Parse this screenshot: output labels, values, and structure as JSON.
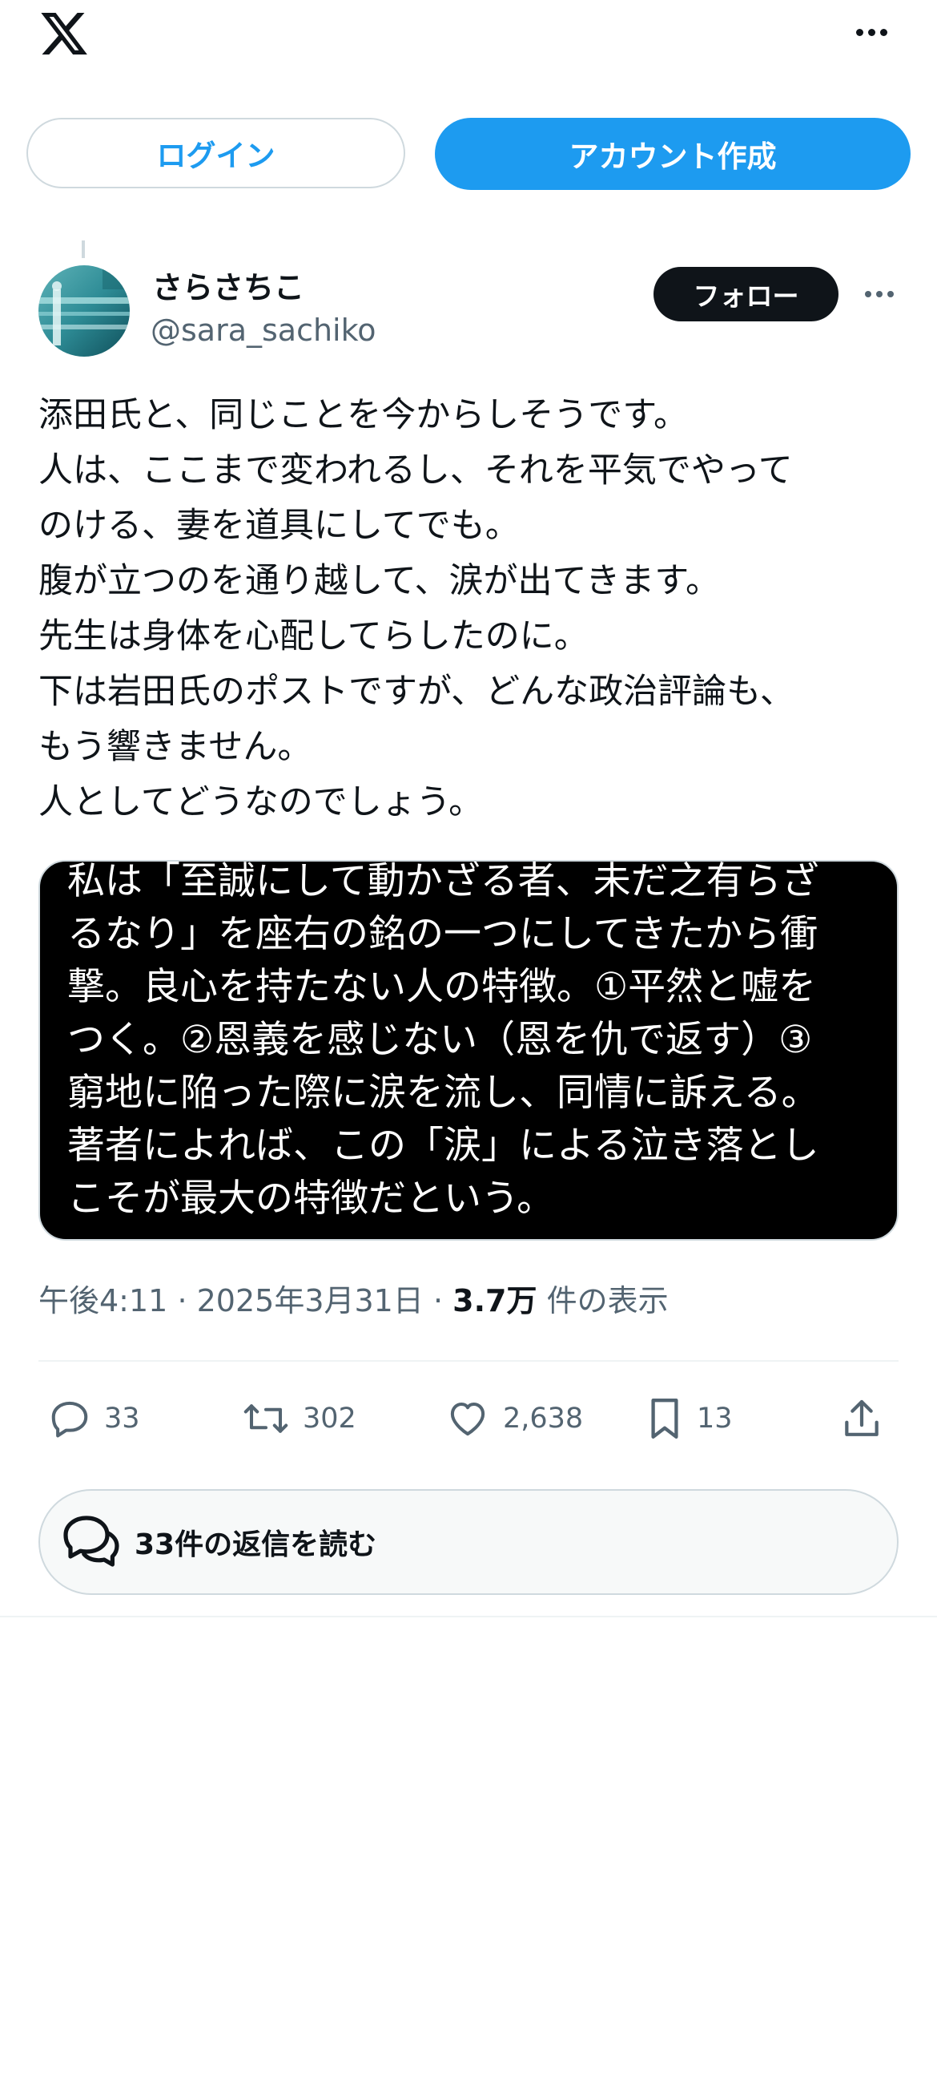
{
  "header": {
    "logo_icon": "x-logo-icon",
    "more_icon": "more-horizontal-icon"
  },
  "auth": {
    "login_label": "ログイン",
    "signup_label": "アカウント作成",
    "accent_color": "#1d9bf0"
  },
  "post": {
    "author": {
      "display_name": "さらさちこ",
      "handle": "@sara_sachiko"
    },
    "follow_label": "フォロー",
    "text_lines": [
      "添田氏と、同じことを今からしそうです。",
      "人は、ここまで変われるし、それを平気でやって",
      "のける、妻を道具にしてでも。",
      "腹が立つのを通り越して、涙が出てきます。",
      "先生は身体を心配してらしたのに。",
      "下は岩田氏のポストですが、どんな政治評論も、",
      "もう響きません。",
      "人としてどうなのでしょう。"
    ],
    "media_text_lines": [
      "私は「至誠にして動かざる者、未だ之有らざ",
      "るなり」を座右の銘の一つにしてきたから衝",
      "撃。良心を持たない人の特徴。①平然と嘘を",
      "つく。②恩義を感じない（恩を仇で返す）③",
      "窮地に陥った際に涙を流し、同情に訴える。",
      "著者によれば、この「涙」による泣き落とし",
      "こそが最大の特徴だという。"
    ],
    "time": "午後4:11",
    "separator": "·",
    "date": "2025年3月31日",
    "views_count": "3.7万",
    "views_label": "件の表示"
  },
  "actions": {
    "replies": "33",
    "reposts": "302",
    "likes": "2,638",
    "bookmarks": "13"
  },
  "read_replies_label": "33件の返信を読む"
}
